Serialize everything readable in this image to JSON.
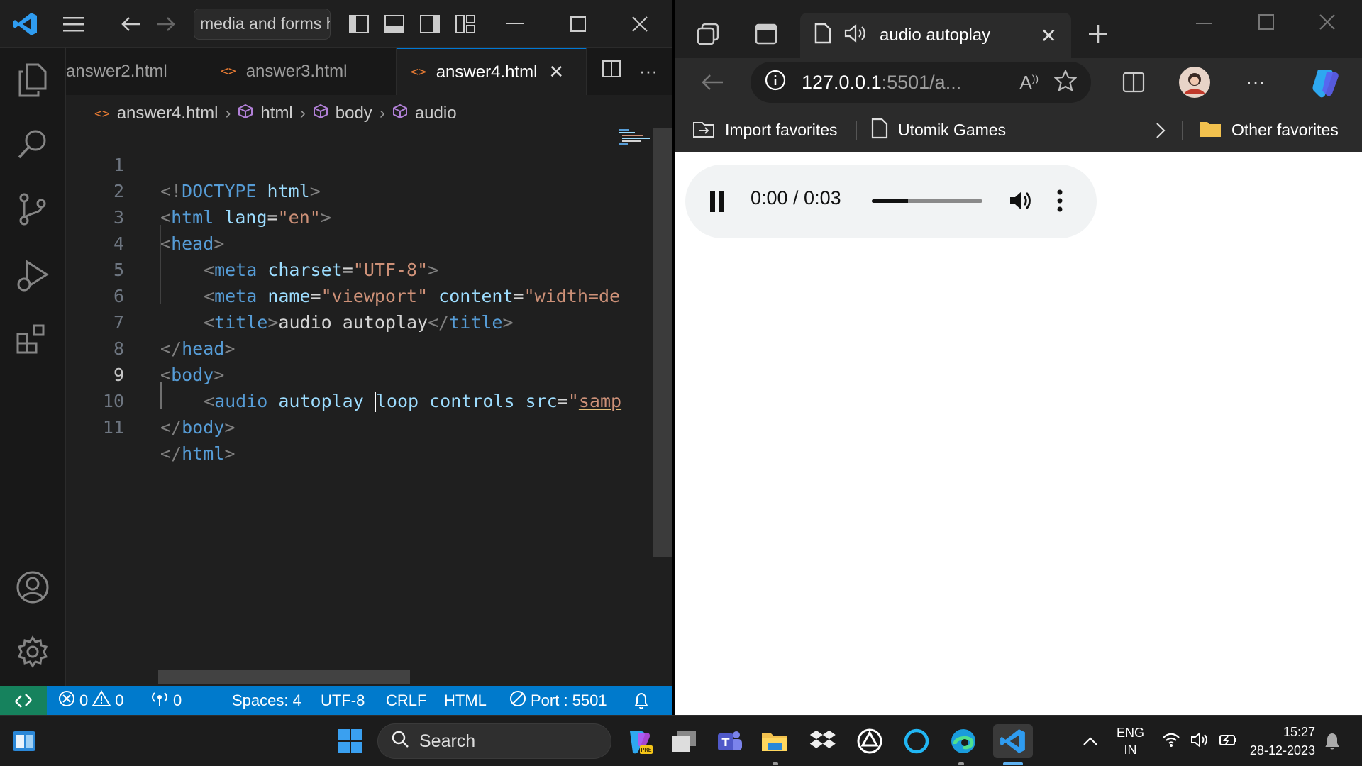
{
  "vscode": {
    "command_center": "media and forms h",
    "tabs": [
      {
        "label": "answer2.html"
      },
      {
        "label": "answer3.html"
      },
      {
        "label": "answer4.html"
      }
    ],
    "breadcrumb": {
      "file": "answer4.html",
      "c1": "html",
      "c2": "body",
      "c3": "audio"
    },
    "line_numbers": [
      "1",
      "2",
      "3",
      "4",
      "5",
      "6",
      "7",
      "8",
      "9",
      "10",
      "11"
    ],
    "code": {
      "l1_a": "<!",
      "l1_b": "DOCTYPE",
      "l1_c": " html",
      "l1_d": ">",
      "l2_a": "<",
      "l2_b": "html",
      "l2_c": " lang",
      "l2_d": "=",
      "l2_e": "\"en\"",
      "l2_f": ">",
      "l3_a": "<",
      "l3_b": "head",
      "l3_c": ">",
      "l4_a": "<",
      "l4_b": "meta",
      "l4_c": " charset",
      "l4_d": "=",
      "l4_e": "\"UTF-8\"",
      "l4_f": ">",
      "l5_a": "<",
      "l5_b": "meta",
      "l5_c": " name",
      "l5_d": "=",
      "l5_e": "\"viewport\"",
      "l5_f": " content",
      "l5_g": "=",
      "l5_h": "\"width=de",
      "l6_a": "<",
      "l6_b": "title",
      "l6_c": ">",
      "l6_d": "audio autoplay",
      "l6_e": "</",
      "l6_f": "title",
      "l6_g": ">",
      "l7_a": "</",
      "l7_b": "head",
      "l7_c": ">",
      "l8_a": "<",
      "l8_b": "body",
      "l8_c": ">",
      "l9_a": "<",
      "l9_b": "audio",
      "l9_c": " autoplay ",
      "l9_d": "loop",
      "l9_e": " controls",
      "l9_f": " src",
      "l9_g": "=",
      "l9_h": "\"",
      "l9_i": "samp",
      "l10_a": "</",
      "l10_b": "body",
      "l10_c": ">",
      "l11_a": "</",
      "l11_b": "html",
      "l11_c": ">"
    },
    "status": {
      "errors": "0",
      "warnings": "0",
      "ports": "0",
      "spaces": "Spaces: 4",
      "encoding": "UTF-8",
      "eol": "CRLF",
      "language": "HTML",
      "port": "Port : 5501"
    }
  },
  "edge": {
    "tab_title": "audio autoplay",
    "url_host": "127.0.0.1",
    "url_rest": ":5501/a...",
    "favorites": {
      "import": "Import favorites",
      "utomik": "Utomik Games",
      "other": "Other favorites"
    },
    "player": {
      "time": "0:00 / 0:03",
      "progress_fraction": 0.33,
      "state": "playing"
    }
  },
  "taskbar": {
    "search_placeholder": "Search",
    "lang_line1": "ENG",
    "lang_line2": "IN",
    "time": "15:27",
    "date": "28-12-2023"
  },
  "colors": {
    "vscode_accent": "#007acc",
    "remote_green": "#16825d",
    "html_orange": "#e37933",
    "tag_blue": "#569cd6",
    "attr_blue": "#9cdcfe",
    "string_orange": "#ce9178",
    "folder_yellow": "#f2c14e"
  }
}
